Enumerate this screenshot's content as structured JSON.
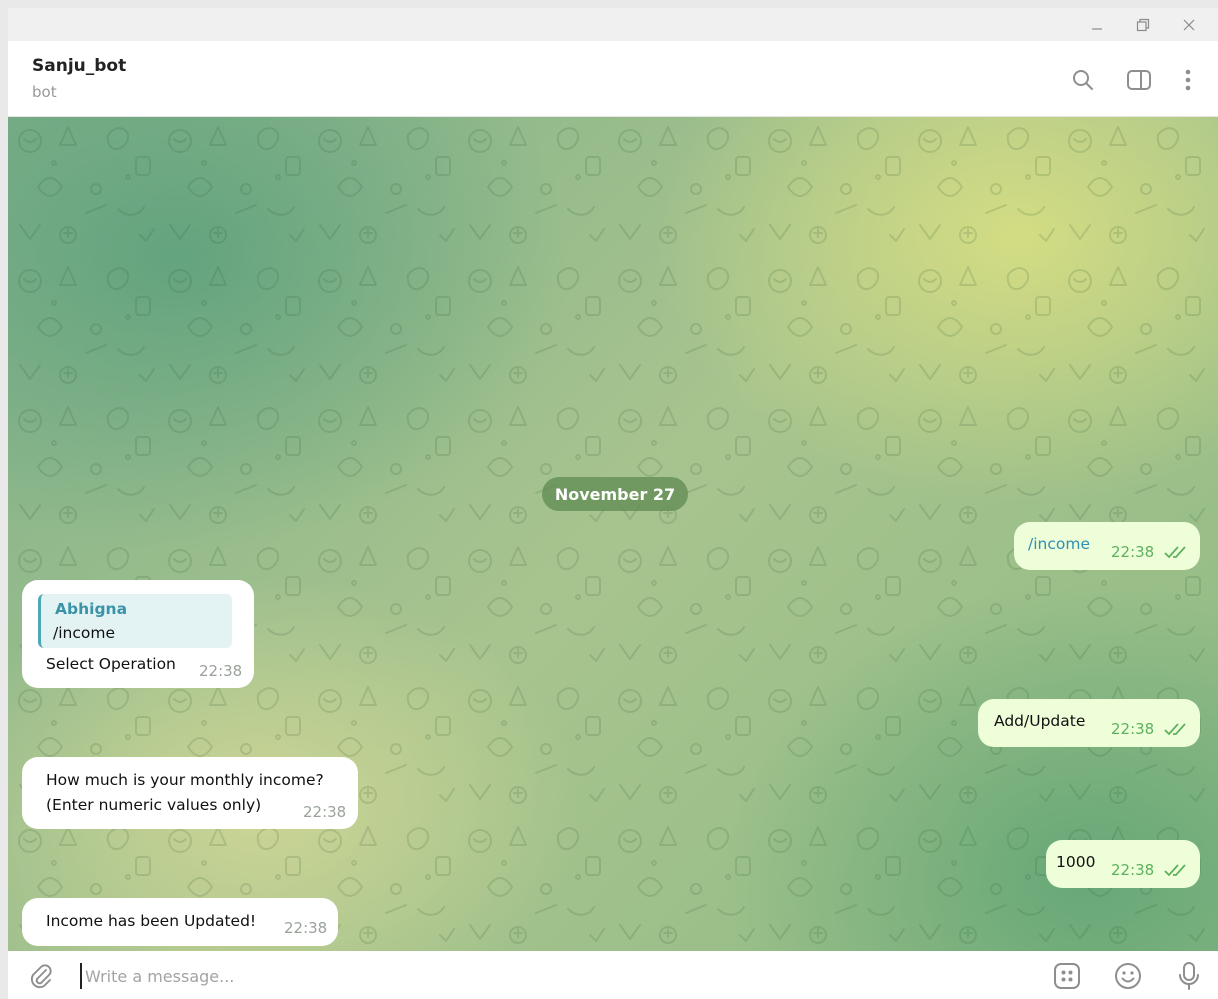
{
  "window": {
    "controls": [
      "minimize-icon",
      "restore-icon",
      "close-icon"
    ]
  },
  "header": {
    "chat_name": "Sanju_bot",
    "chat_status": "bot",
    "icons": [
      "search-icon",
      "sidebar-toggle-icon",
      "more-vert-icon"
    ]
  },
  "chat": {
    "date_separator": "November 27",
    "messages": [
      {
        "direction": "outgoing",
        "text": "/income",
        "time": "22:38",
        "status": "read"
      },
      {
        "direction": "incoming",
        "reply_to": {
          "author": "Abhigna",
          "text": "/income"
        },
        "text": "Select Operation",
        "time": "22:38"
      },
      {
        "direction": "outgoing",
        "text": "Add/Update",
        "time": "22:38",
        "status": "read"
      },
      {
        "direction": "incoming",
        "lines": [
          "How much is your monthly income?",
          "(Enter numeric values only)"
        ],
        "time": "22:38"
      },
      {
        "direction": "outgoing",
        "text": "1000",
        "time": "22:38",
        "status": "read"
      },
      {
        "direction": "incoming",
        "text": "Income has been Updated!",
        "time": "22:38"
      }
    ]
  },
  "composer": {
    "placeholder": "Write a message...",
    "icons": [
      "attach-icon",
      "bot-commands-icon",
      "emoji-icon",
      "microphone-icon"
    ]
  }
}
